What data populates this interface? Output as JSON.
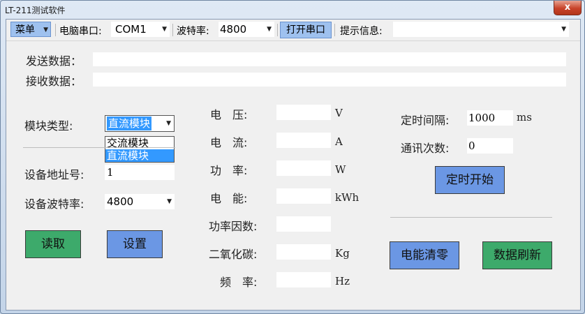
{
  "window": {
    "title": "LT-211测试软件",
    "close_label": "x"
  },
  "toolbar": {
    "menu_label": "菜单",
    "port_label": "电脑串口:",
    "port_value": "COM1",
    "baud_label": "波特率:",
    "baud_value": "4800",
    "open_port_label": "打开串口",
    "info_label": "提示信息:",
    "info_value": ""
  },
  "send": {
    "label": "发送数据：",
    "value": ""
  },
  "receive": {
    "label": "接收数据：",
    "value": ""
  },
  "module": {
    "label": "模块类型:",
    "selected": "直流模块",
    "options": [
      "交流模块",
      "直流模块"
    ]
  },
  "device": {
    "address_label": "设备地址号:",
    "address_value": "1",
    "baud_label": "设备波特率:",
    "baud_value": "4800",
    "read_label": "读取",
    "set_label": "设置"
  },
  "measurements": [
    {
      "label": "电　压:",
      "value": "",
      "unit": "V"
    },
    {
      "label": "电　流:",
      "value": "",
      "unit": "A"
    },
    {
      "label": "功　率:",
      "value": "",
      "unit": "W"
    },
    {
      "label": "电　能:",
      "value": "",
      "unit": "kWh"
    },
    {
      "label": "功率因数:",
      "value": "",
      "unit": ""
    },
    {
      "label": "二氧化碳:",
      "value": "",
      "unit": "Kg"
    },
    {
      "label": "频　率:",
      "value": "",
      "unit": "Hz"
    }
  ],
  "timer": {
    "interval_label": "定时间隔:",
    "interval_value": "1000",
    "interval_unit": "ms",
    "count_label": "通讯次数:",
    "count_value": "0",
    "start_label": "定时开始"
  },
  "actions": {
    "clear_label": "电能清零",
    "refresh_label": "数据刷新"
  }
}
